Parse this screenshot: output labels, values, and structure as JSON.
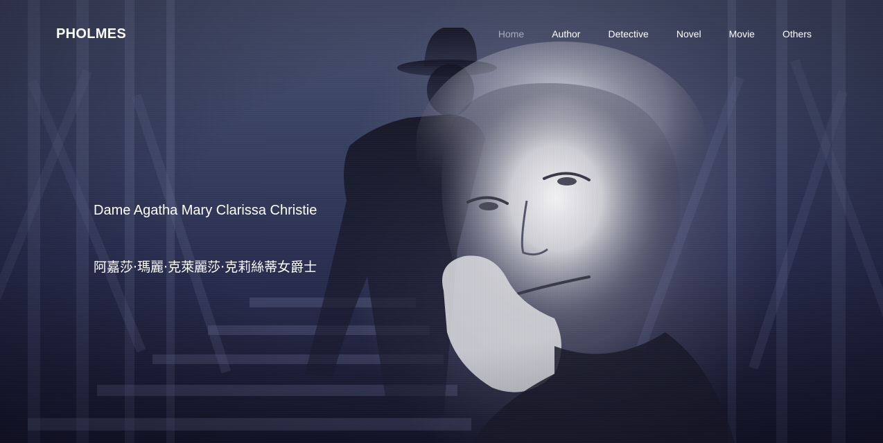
{
  "brand": {
    "name": "PHOLMES"
  },
  "nav": {
    "items": [
      {
        "label": "Home",
        "active": true
      },
      {
        "label": "Author",
        "active": false
      },
      {
        "label": "Detective",
        "active": false
      },
      {
        "label": "Novel",
        "active": false
      },
      {
        "label": "Movie",
        "active": false
      },
      {
        "label": "Others",
        "active": false
      }
    ]
  },
  "hero": {
    "name_en": "Dame Agatha Mary Clarissa Christie",
    "name_zh": "阿嘉莎·瑪麗·克萊麗莎·克莉絲蒂女爵士",
    "background_description_icon": "bridge-railway-silhouette-portrait-image"
  },
  "colors": {
    "nav_text": "#ffffff",
    "nav_active": "#a8abbd",
    "background_top": "#4a5270",
    "background_bottom": "#15152a"
  }
}
